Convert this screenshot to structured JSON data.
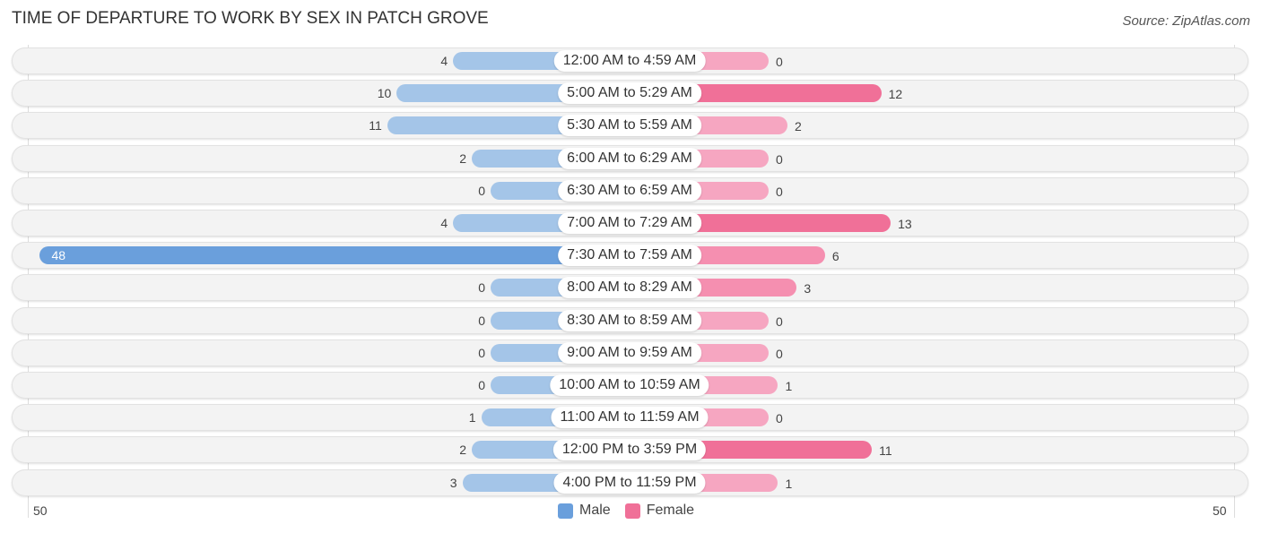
{
  "header": {
    "title": "TIME OF DEPARTURE TO WORK BY SEX IN PATCH GROVE",
    "source": "Source: ZipAtlas.com"
  },
  "colors": {
    "male_light": "#a4c5e8",
    "male_strong": "#6a9fdc",
    "female_light": "#f6a6c1",
    "female_strong": "#f07098"
  },
  "chart_data": {
    "type": "bar",
    "orientation": "horizontal-diverging",
    "title": "TIME OF DEPARTURE TO WORK BY SEX IN PATCH GROVE",
    "categories": [
      "12:00 AM to 4:59 AM",
      "5:00 AM to 5:29 AM",
      "5:30 AM to 5:59 AM",
      "6:00 AM to 6:29 AM",
      "6:30 AM to 6:59 AM",
      "7:00 AM to 7:29 AM",
      "7:30 AM to 7:59 AM",
      "8:00 AM to 8:29 AM",
      "8:30 AM to 8:59 AM",
      "9:00 AM to 9:59 AM",
      "10:00 AM to 10:59 AM",
      "11:00 AM to 11:59 AM",
      "12:00 PM to 3:59 PM",
      "4:00 PM to 11:59 PM"
    ],
    "series": [
      {
        "name": "Male",
        "values": [
          4,
          10,
          11,
          2,
          0,
          4,
          48,
          0,
          0,
          0,
          0,
          1,
          2,
          3
        ]
      },
      {
        "name": "Female",
        "values": [
          0,
          12,
          2,
          0,
          0,
          13,
          6,
          3,
          0,
          0,
          1,
          0,
          11,
          1
        ]
      }
    ],
    "axis": {
      "left_tick": "50",
      "right_tick": "50",
      "range": [
        0,
        50
      ]
    },
    "legend": {
      "position": "bottom-center",
      "entries": [
        "Male",
        "Female"
      ]
    },
    "xlabel": "",
    "ylabel": ""
  }
}
